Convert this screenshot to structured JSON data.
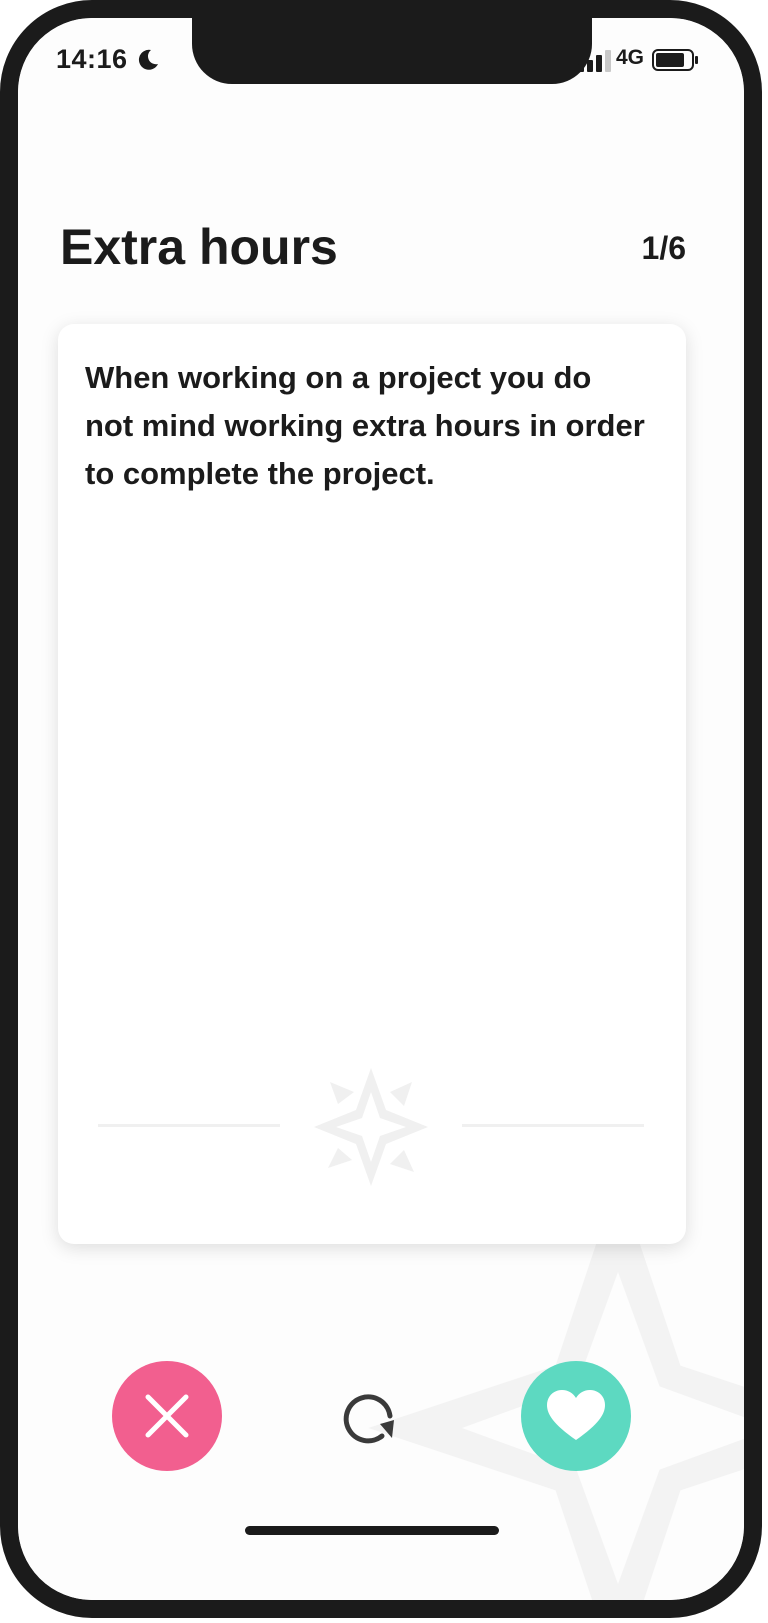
{
  "status_bar": {
    "time": "14:16",
    "network": "4G",
    "icons": [
      "moon-icon",
      "signal-icon",
      "battery-icon"
    ]
  },
  "header": {
    "title": "Extra hours",
    "progress": "1/6"
  },
  "card": {
    "statement": "When working on a project you do not mind working extra hours in order to complete the project."
  },
  "actions": {
    "dislike_icon": "close-icon",
    "undo_icon": "undo-icon",
    "like_icon": "heart-icon"
  },
  "colors": {
    "dislike": "#f25f8f",
    "like": "#5dd9c1",
    "text": "#1b1b1b"
  }
}
